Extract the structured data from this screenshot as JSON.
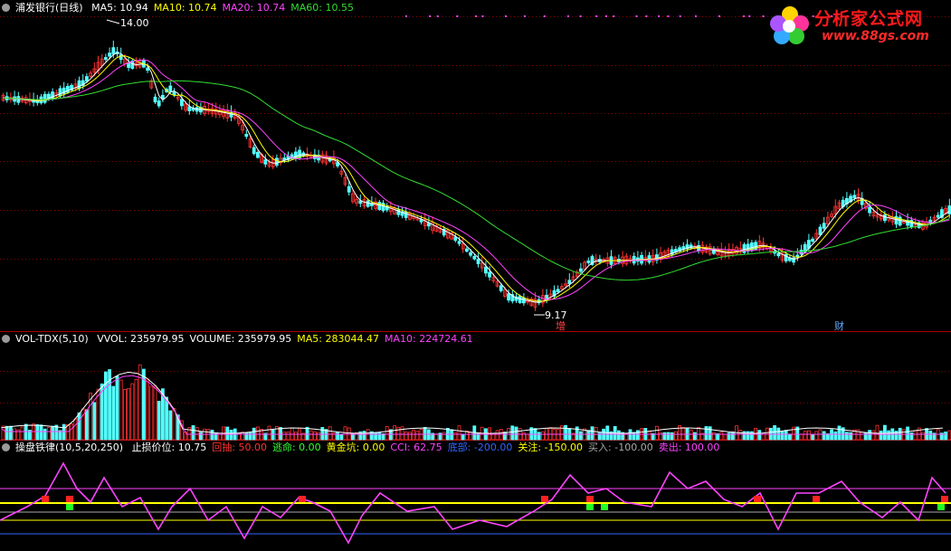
{
  "main_header": {
    "title": "浦发银行(日线)",
    "items": [
      {
        "label": "MA5: 10.94",
        "color": "#ffffff"
      },
      {
        "label": "MA10: 10.74",
        "color": "#ffff00"
      },
      {
        "label": "MA20: 10.74",
        "color": "#ff44ff"
      },
      {
        "label": "MA60: 10.55",
        "color": "#33dd33"
      }
    ]
  },
  "annotations": {
    "high_label": "14.00",
    "low_label": "9.17",
    "marker_zeng": "增",
    "marker_cai": "财"
  },
  "volume_header": {
    "title": "VOL-TDX(5,10)",
    "items": [
      {
        "label": "VVOL: 235979.95",
        "color": "#ffffff"
      },
      {
        "label": "VOLUME: 235979.95",
        "color": "#ffffff"
      },
      {
        "label": "MA5: 283044.47",
        "color": "#ffff00"
      },
      {
        "label": "MA10: 224724.61",
        "color": "#ff44ff"
      }
    ]
  },
  "indicator_header": {
    "title": "操盘铁律(10,5,20,250)",
    "items": [
      {
        "label": "止损价位: 10.75",
        "color": "#ffffff"
      },
      {
        "label": "回抽: 50.00",
        "color": "#ff3333"
      },
      {
        "label": "逃命: 0.00",
        "color": "#33ff33"
      },
      {
        "label": "黄金坑: 0.00",
        "color": "#ffff00"
      },
      {
        "label": "CCI: 62.75",
        "color": "#ff44ff"
      },
      {
        "label": "底部: -200.00",
        "color": "#3366ff"
      },
      {
        "label": "关注: -150.00",
        "color": "#ffff00"
      },
      {
        "label": "买入: -100.00",
        "color": "#aaaaaa"
      },
      {
        "label": "卖出: 100.00",
        "color": "#ff44ff"
      }
    ]
  },
  "logo": {
    "brand": "分析家公式网",
    "url": "www.88gs.com"
  },
  "colors": {
    "up": "#ff3232",
    "down": "#54ffff",
    "grid": "#8b0000",
    "ma5": "#ffffff",
    "ma10": "#ffff00",
    "ma20": "#ff44ff",
    "ma60": "#33dd33"
  }
}
